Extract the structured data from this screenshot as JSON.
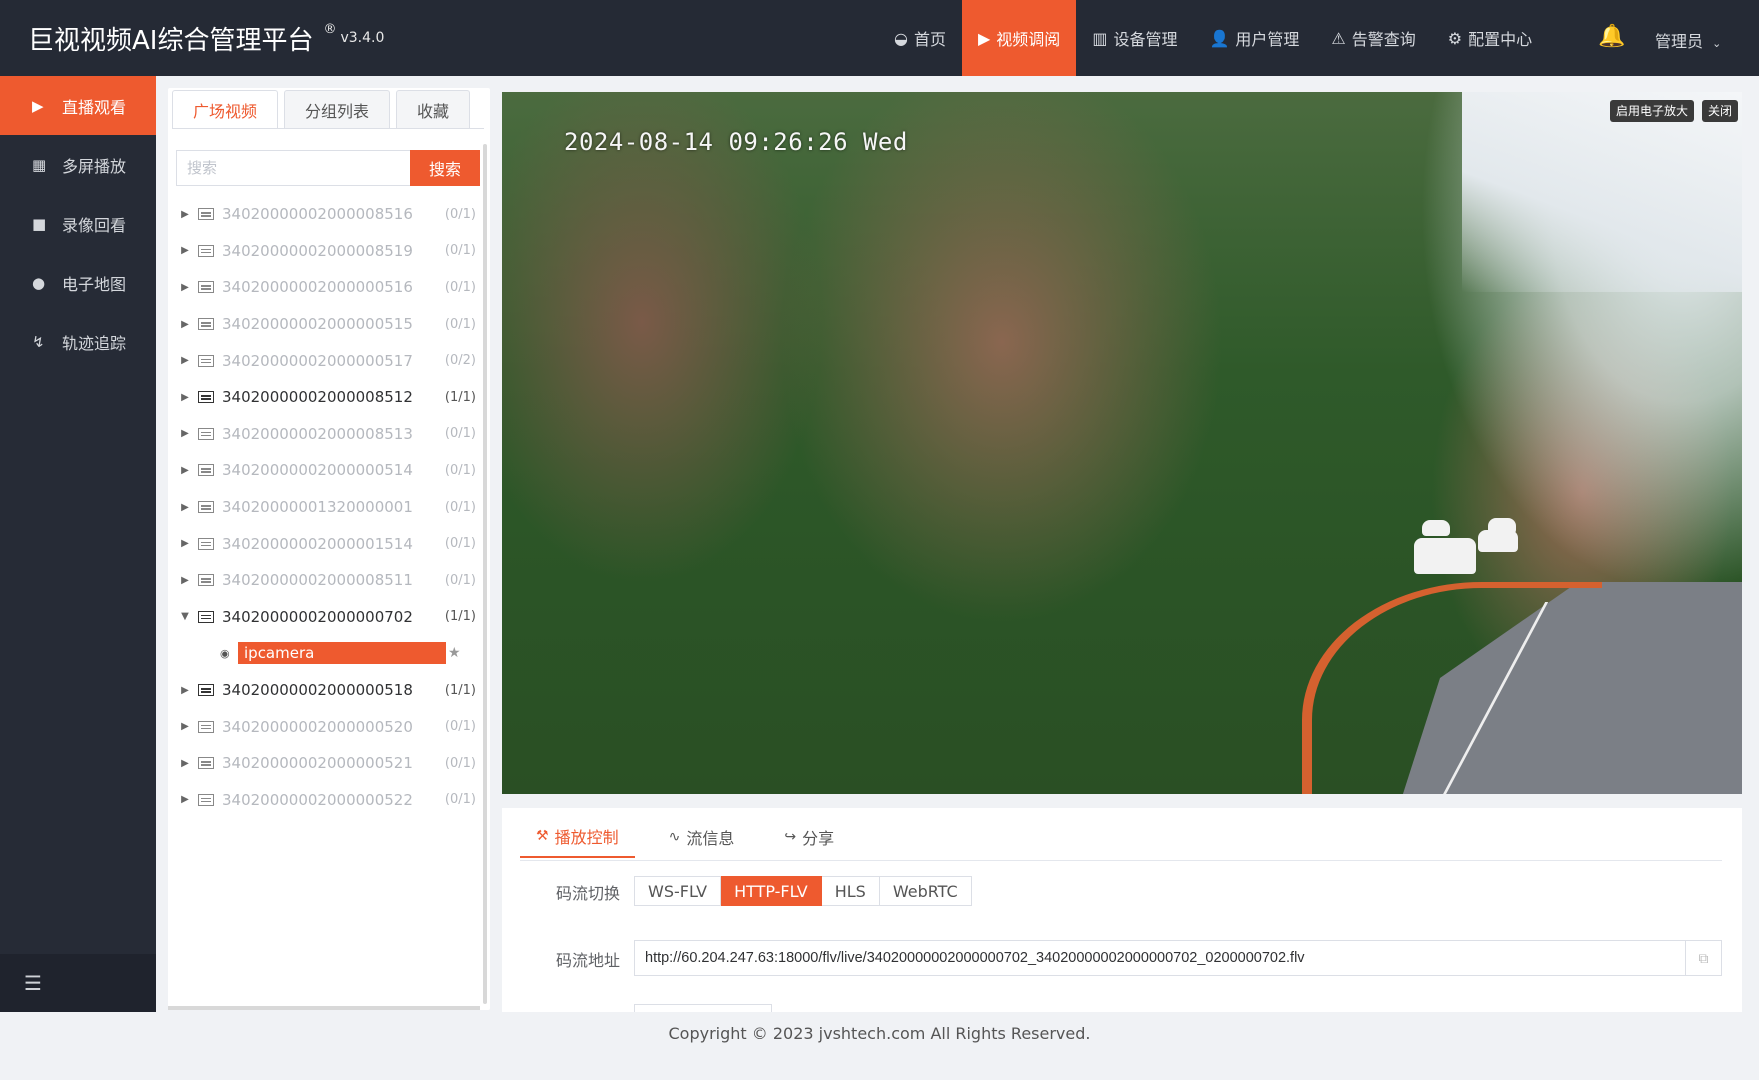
{
  "app": {
    "title": "巨视视频AI综合管理平台",
    "reg": "®",
    "version": "v3.4.0"
  },
  "topnav": [
    {
      "label": "首页",
      "icon": "dashboard-icon",
      "glyph": "◒"
    },
    {
      "label": "视频调阅",
      "icon": "play-circle-icon",
      "glyph": "▶",
      "active": true
    },
    {
      "label": "设备管理",
      "icon": "device-icon",
      "glyph": "▥"
    },
    {
      "label": "用户管理",
      "icon": "user-icon",
      "glyph": "👤"
    },
    {
      "label": "告警查询",
      "icon": "alarm-icon",
      "glyph": "⚠"
    },
    {
      "label": "配置中心",
      "icon": "gear-icon",
      "glyph": "⚙"
    }
  ],
  "header": {
    "user": "管理员"
  },
  "sidebar": {
    "items": [
      {
        "label": "直播观看",
        "icon": "play-circle-icon",
        "glyph": "▶",
        "active": true
      },
      {
        "label": "多屏播放",
        "icon": "grid-icon",
        "glyph": "▦"
      },
      {
        "label": "录像回看",
        "icon": "video-camera-icon",
        "glyph": "■"
      },
      {
        "label": "电子地图",
        "icon": "map-pin-icon",
        "glyph": "●"
      },
      {
        "label": "轨迹追踪",
        "icon": "track-icon",
        "glyph": "↯"
      }
    ]
  },
  "tree_panel": {
    "tabs": [
      {
        "label": "广场视频",
        "active": true
      },
      {
        "label": "分组列表"
      },
      {
        "label": "收藏"
      }
    ],
    "search": {
      "placeholder": "搜索",
      "button": "搜索"
    },
    "nodes": [
      {
        "id": "34020000002000008516",
        "count": "(0/1)",
        "online": false
      },
      {
        "id": "34020000002000008519",
        "count": "(0/1)",
        "online": false
      },
      {
        "id": "34020000002000000516",
        "count": "(0/1)",
        "online": false
      },
      {
        "id": "34020000002000000515",
        "count": "(0/1)",
        "online": false
      },
      {
        "id": "34020000002000000517",
        "count": "(0/2)",
        "online": false
      },
      {
        "id": "34020000002000008512",
        "count": "(1/1)",
        "online": true
      },
      {
        "id": "34020000002000008513",
        "count": "(0/1)",
        "online": false
      },
      {
        "id": "34020000002000000514",
        "count": "(0/1)",
        "online": false
      },
      {
        "id": "34020000001320000001",
        "count": "(0/1)",
        "online": false
      },
      {
        "id": "34020000002000001514",
        "count": "(0/1)",
        "online": false
      },
      {
        "id": "34020000002000008511",
        "count": "(0/1)",
        "online": false
      },
      {
        "id": "34020000002000000702",
        "count": "(1/1)",
        "online": true,
        "expanded": true,
        "child": "ipcamera"
      },
      {
        "id": "34020000002000000518",
        "count": "(1/1)",
        "online": true
      },
      {
        "id": "34020000002000000520",
        "count": "(0/1)",
        "online": false
      },
      {
        "id": "34020000002000000521",
        "count": "(0/1)",
        "online": false
      },
      {
        "id": "34020000002000000522",
        "count": "(0/1)",
        "online": false
      }
    ]
  },
  "video": {
    "timestamp": "2024-08-14 09:26:26 Wed",
    "zoom_button": "启用电子放大",
    "close_button": "关闭"
  },
  "control": {
    "tabs": [
      {
        "label": "播放控制",
        "icon": "tools-icon",
        "glyph": "⚒",
        "active": true
      },
      {
        "label": "流信息",
        "icon": "pulse-icon",
        "glyph": "∿"
      },
      {
        "label": "分享",
        "icon": "share-icon",
        "glyph": "↪"
      }
    ],
    "stream_label": "码流切换",
    "streams": [
      {
        "label": "WS-FLV"
      },
      {
        "label": "HTTP-FLV",
        "active": true
      },
      {
        "label": "HLS"
      },
      {
        "label": "WebRTC"
      }
    ],
    "url_label": "码流地址",
    "url": "http://60.204.247.63:18000/flv/live/34020000002000000702_34020000002000000702_0200000702.flv"
  },
  "footer": {
    "copyright": "Copyright © 2023 jvshtech.com All Rights Reserved."
  }
}
